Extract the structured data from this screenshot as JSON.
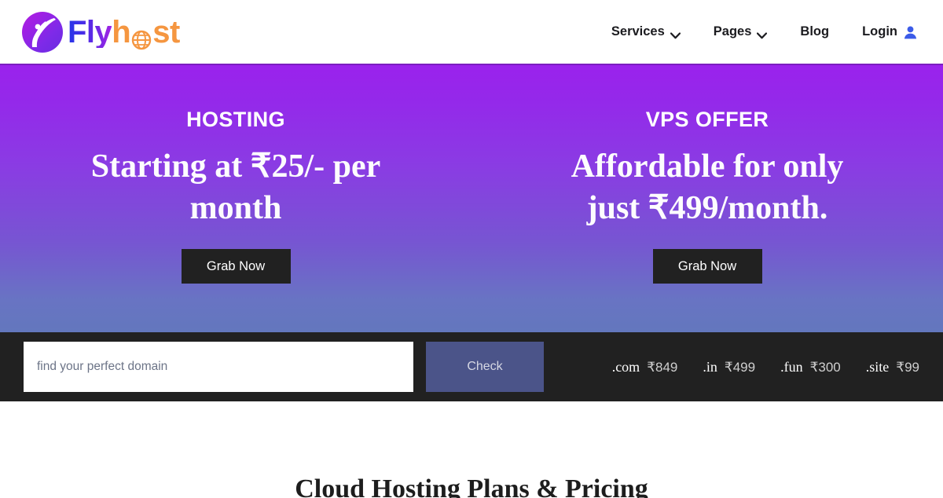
{
  "header": {
    "brand": {
      "name_part1": "Fly",
      "name_part2_a": "h",
      "name_part2_b": "st",
      "logo_icon": "flyhost-logo-icon",
      "globe_icon": "globe-icon",
      "colors": {
        "fly_gradient_start": "#2536e8",
        "fly_gradient_end": "#a324e4",
        "host_orange": "#f59640",
        "mark_gradient_start": "#b01fe0",
        "mark_gradient_end": "#6a2ce0"
      }
    },
    "nav": [
      {
        "label": "Services",
        "has_dropdown": true,
        "icon": "chevron-down-icon"
      },
      {
        "label": "Pages",
        "has_dropdown": true,
        "icon": "chevron-down-icon"
      },
      {
        "label": "Blog",
        "has_dropdown": false,
        "icon": ""
      },
      {
        "label": "Login",
        "has_dropdown": false,
        "icon": "user-icon"
      }
    ],
    "login_icon_color": "#3b5be8"
  },
  "hero": {
    "background_gradient_top": "#9a22ec",
    "background_gradient_bottom": "#6377bd",
    "left": {
      "kicker": "HOSTING",
      "title": "Starting at ₹25/- per month",
      "button_label": "Grab Now"
    },
    "right": {
      "kicker": "VPS OFFER",
      "title": "Affordable for only just ₹499/month.",
      "button_label": "Grab Now"
    },
    "button_color": "#212121"
  },
  "domain_search": {
    "background": "#212121",
    "input_value": "",
    "input_placeholder": "find your perfect domain",
    "check_button_label": "Check",
    "check_button_color": "#4b5489",
    "tlds": [
      {
        "name": ".com",
        "price": "₹849"
      },
      {
        "name": ".in",
        "price": "₹499"
      },
      {
        "name": ".fun",
        "price": "₹300"
      },
      {
        "name": ".site",
        "price": "₹99"
      }
    ]
  },
  "pricing_section": {
    "title": "Cloud Hosting Plans & Pricing"
  }
}
